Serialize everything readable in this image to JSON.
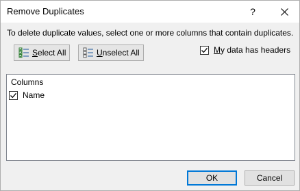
{
  "window": {
    "title": "Remove Duplicates",
    "help_glyph": "?"
  },
  "instruction": "To delete duplicate values, select one or more columns that contain duplicates.",
  "toolbar": {
    "select_all_label_access": "S",
    "select_all_label_rest": "elect All",
    "unselect_all_label_access": "U",
    "unselect_all_label_rest": "nselect All"
  },
  "has_headers": {
    "label_access": "M",
    "label_rest": "y data has headers",
    "checked": true
  },
  "columns": {
    "header": "Columns",
    "items": [
      {
        "label": "Name",
        "checked": true
      }
    ]
  },
  "buttons": {
    "ok_label": "OK",
    "cancel_label": "Cancel"
  }
}
